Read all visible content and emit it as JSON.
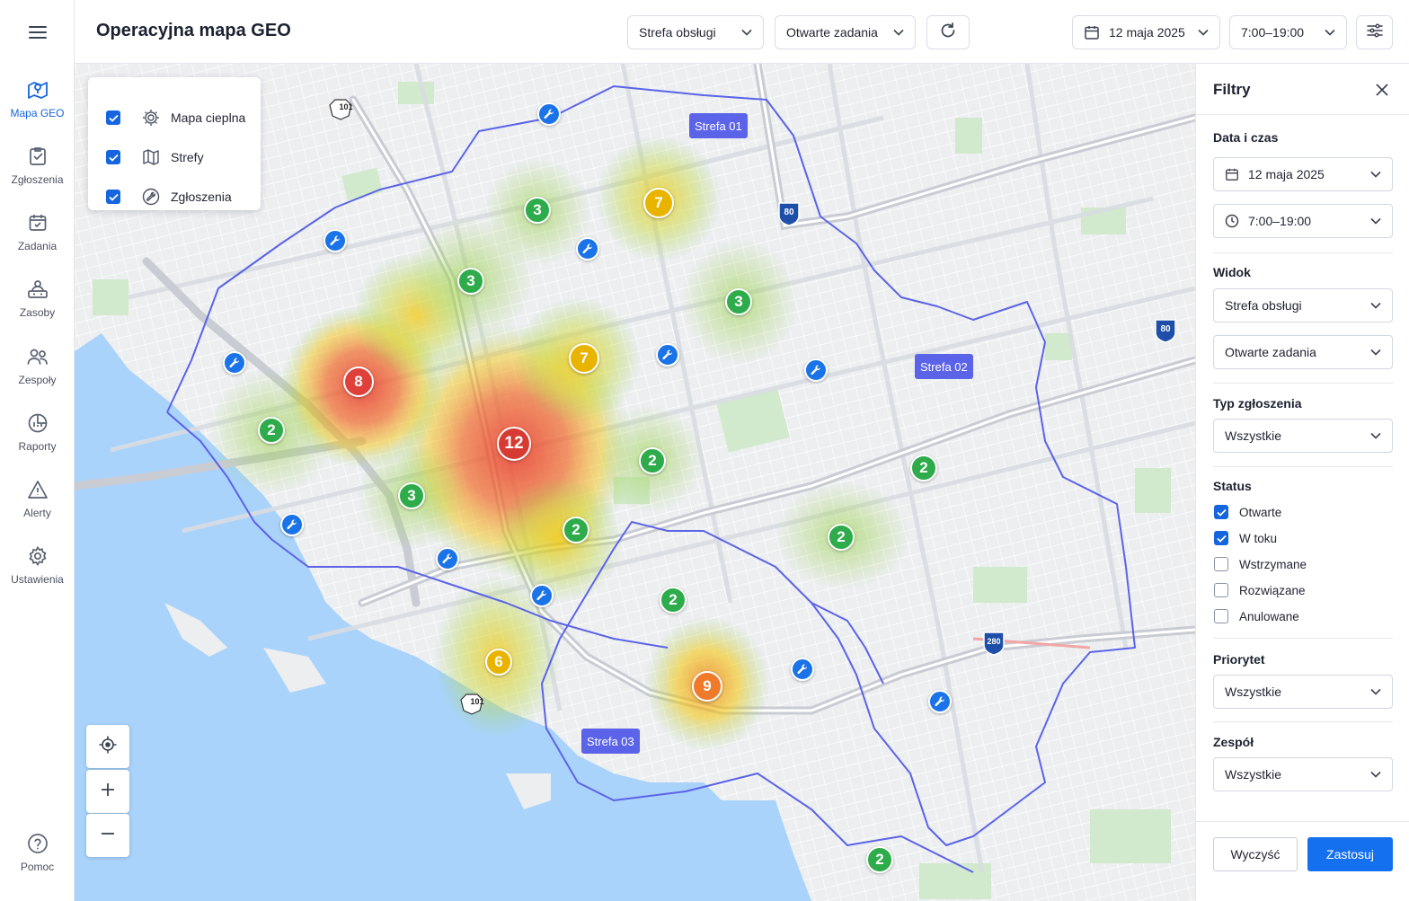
{
  "header": {
    "title": "Operacyjna mapa GEO",
    "zone_select": "Strefa obsługi",
    "tasks_select": "Otwarte zadania",
    "date": "12 maja 2025",
    "time": "7:00–19:00"
  },
  "sidebar": {
    "items": [
      {
        "label": "Mapa GEO",
        "icon": "map-pin-icon",
        "active": true
      },
      {
        "label": "Zgłoszenia",
        "icon": "clipboard-check-icon"
      },
      {
        "label": "Zadania",
        "icon": "calendar-check-icon"
      },
      {
        "label": "Zasoby",
        "icon": "resources-icon"
      },
      {
        "label": "Zespoły",
        "icon": "users-icon"
      },
      {
        "label": "Raporty",
        "icon": "report-chart-icon"
      },
      {
        "label": "Alerty",
        "icon": "alert-triangle-icon"
      },
      {
        "label": "Ustawienia",
        "icon": "settings-gear-icon"
      }
    ],
    "help_label": "Pomoc"
  },
  "map": {
    "layers": [
      {
        "label": "Mapa cieplna",
        "checked": true,
        "icon": "heatmap-icon"
      },
      {
        "label": "Strefy",
        "checked": true,
        "icon": "zones-map-icon"
      },
      {
        "label": "Zgłoszenia",
        "checked": true,
        "icon": "tickets-icon"
      }
    ],
    "zones": [
      "Strefa 01",
      "Strefa 02",
      "Strefa 03"
    ],
    "clusters": [
      "3",
      "7",
      "3",
      "3",
      "8",
      "7",
      "12",
      "2",
      "2",
      "3",
      "2",
      "2",
      "2",
      "2",
      "6",
      "9",
      "2"
    ],
    "road_shields": [
      "101",
      "80",
      "80",
      "280",
      "101"
    ]
  },
  "filters": {
    "title": "Filtry",
    "date_section": "Data i czas",
    "date": "12 maja 2025",
    "time": "7:00–19:00",
    "view_section": "Widok",
    "view_zone": "Strefa obsługi",
    "view_tasks": "Otwarte zadania",
    "type_section": "Typ zgłoszenia",
    "type_value": "Wszystkie",
    "status_section": "Status",
    "statuses": [
      {
        "label": "Otwarte",
        "checked": true
      },
      {
        "label": "W toku",
        "checked": true
      },
      {
        "label": "Wstrzymane",
        "checked": false
      },
      {
        "label": "Rozwiązane",
        "checked": false
      },
      {
        "label": "Anulowane",
        "checked": false
      }
    ],
    "priority_section": "Priorytet",
    "priority_value": "Wszystkie",
    "team_section": "Zespół",
    "team_value": "Wszystkie",
    "clear_label": "Wyczyść",
    "apply_label": "Zastosuj"
  },
  "colors": {
    "accent": "#1565e0",
    "zone_border": "#5b63e8",
    "cluster_green": "#2eab4a",
    "cluster_yellow": "#e8b400",
    "cluster_orange": "#ee7a2a",
    "cluster_red": "#e0403a",
    "water": "#a9d3fb"
  }
}
